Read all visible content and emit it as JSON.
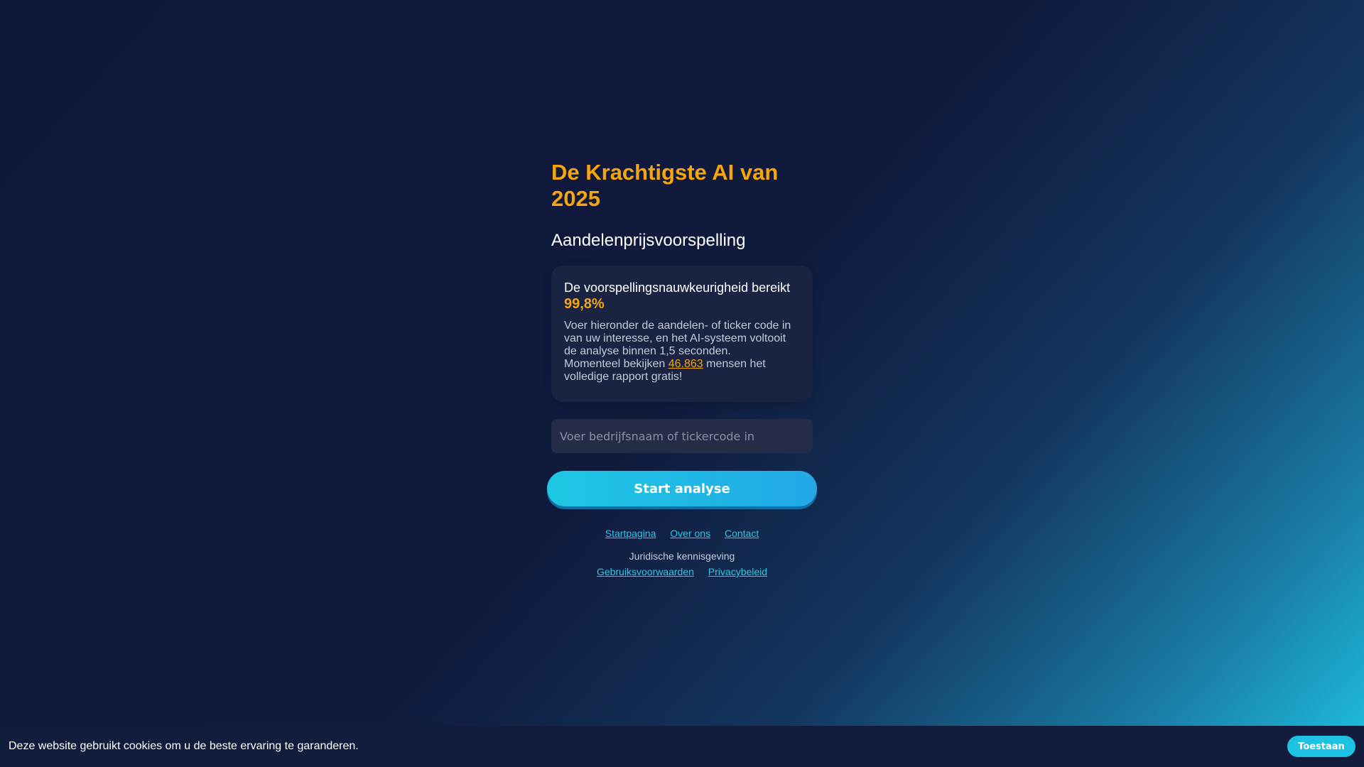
{
  "hero": {
    "title": "De Krachtigste AI van 2025",
    "subtitle": "Aandelenprijsvoorspelling"
  },
  "info_card": {
    "accuracy_label": "De voorspellingsnauwkeurigheid bereikt",
    "accuracy_value": "99,8%",
    "description": "Voer hieronder de aandelen- of ticker code in van uw interesse, en het AI-systeem voltooit de analyse binnen 1,5 seconden.",
    "viewers_prefix": "Momenteel bekijken",
    "viewers_count": "46.863",
    "viewers_suffix": "mensen het volledige rapport gratis!"
  },
  "search": {
    "placeholder": "Voer bedrijfsnaam of tickercode in",
    "value": ""
  },
  "start_button": {
    "label": "Start analyse"
  },
  "nav_links": [
    {
      "label": "Startpagina"
    },
    {
      "label": "Over ons"
    },
    {
      "label": "Contact"
    }
  ],
  "legal": {
    "heading": "Juridische kennisgeving",
    "links": [
      {
        "label": "Gebruiksvoorwaarden"
      },
      {
        "label": "Privacybeleid"
      }
    ]
  },
  "cookie_banner": {
    "text": "Deze website gebruikt cookies om u de beste ervaring te garanderen.",
    "accept_label": "Toestaan"
  },
  "colors": {
    "accent_orange": "#f5a60e",
    "accent_cyan": "#1ec2e2",
    "background_dark": "#0f1738"
  }
}
